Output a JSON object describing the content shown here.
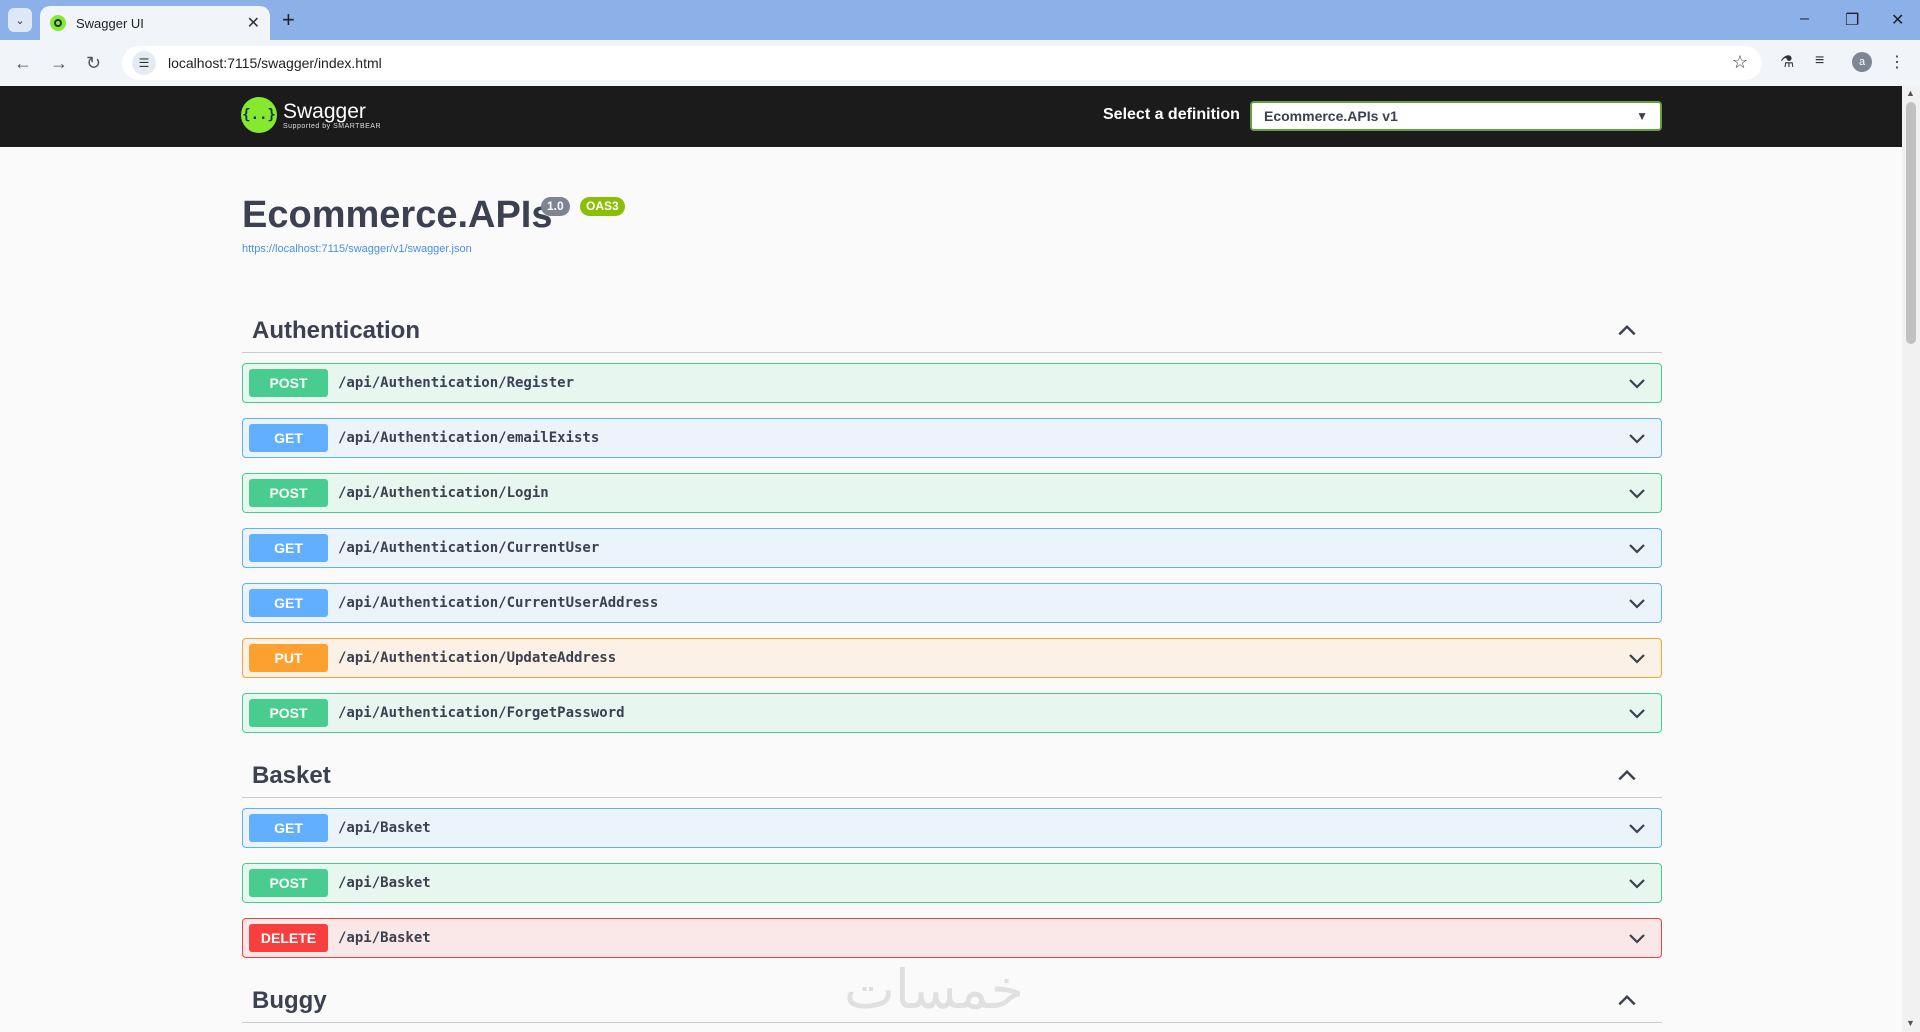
{
  "browser": {
    "tab_title": "Swagger UI",
    "url": "localhost:7115/swagger/index.html",
    "avatar_letter": "a"
  },
  "swagger": {
    "logo_text": "Swagger",
    "logo_subtext": "Supported by SMARTBEAR",
    "select_label": "Select a definition",
    "selected_definition": "Ecommerce.APIs v1"
  },
  "info": {
    "title": "Ecommerce.APIs",
    "version": "1.0",
    "oas": "OAS3",
    "spec_url": "https://localhost:7115/swagger/v1/swagger.json"
  },
  "sections": [
    {
      "name": "Authentication",
      "operations": [
        {
          "method": "POST",
          "path": "/api/Authentication/Register"
        },
        {
          "method": "GET",
          "path": "/api/Authentication/emailExists"
        },
        {
          "method": "POST",
          "path": "/api/Authentication/Login"
        },
        {
          "method": "GET",
          "path": "/api/Authentication/CurrentUser"
        },
        {
          "method": "GET",
          "path": "/api/Authentication/CurrentUserAddress"
        },
        {
          "method": "PUT",
          "path": "/api/Authentication/UpdateAddress"
        },
        {
          "method": "POST",
          "path": "/api/Authentication/ForgetPassword"
        }
      ]
    },
    {
      "name": "Basket",
      "operations": [
        {
          "method": "GET",
          "path": "/api/Basket"
        },
        {
          "method": "POST",
          "path": "/api/Basket"
        },
        {
          "method": "DELETE",
          "path": "/api/Basket"
        }
      ]
    },
    {
      "name": "Buggy",
      "operations": []
    }
  ],
  "watermark": "خمسات",
  "colors": {
    "post": "#49cc90",
    "get": "#61affe",
    "put": "#fca130",
    "delete": "#f93e3e",
    "swagger_green": "#85ea2d"
  }
}
